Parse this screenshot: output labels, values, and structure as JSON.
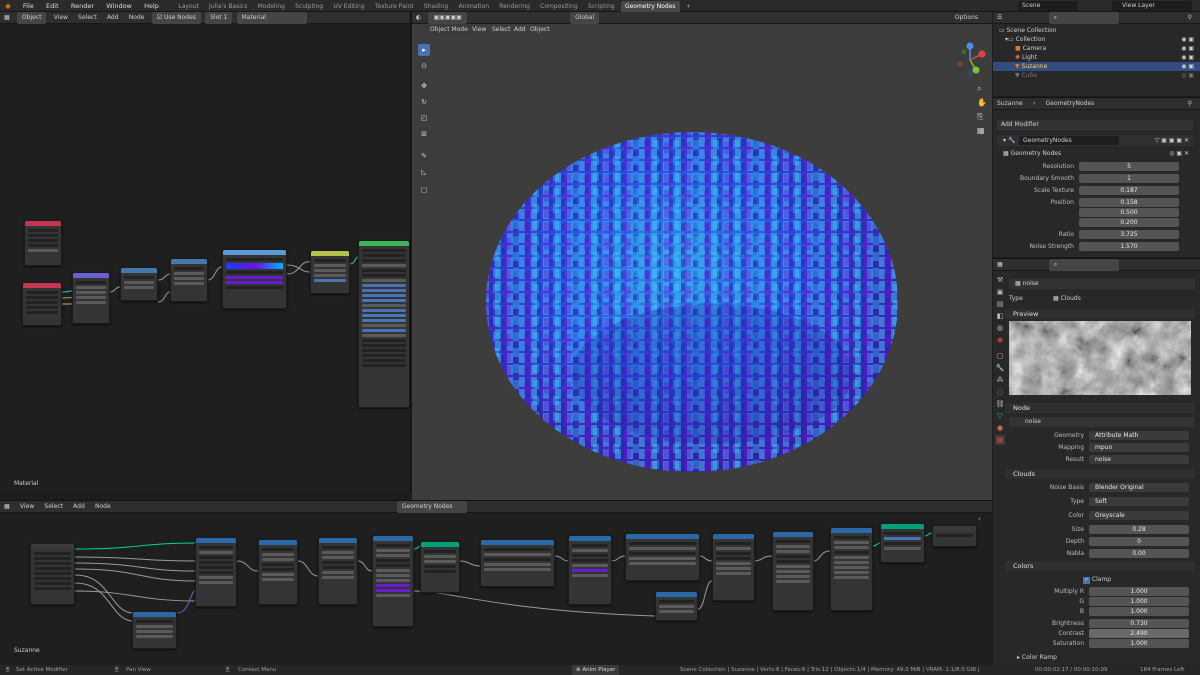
{
  "app": {
    "blender_icon": "blender-logo-icon"
  },
  "menu": [
    "File",
    "Edit",
    "Render",
    "Window",
    "Help"
  ],
  "workspaces": [
    "Layout",
    "Julia's Basics",
    "Modeling",
    "Sculpting",
    "UV Editing",
    "Texture Paint",
    "Shading",
    "Animation",
    "Rendering",
    "Compositing",
    "Scripting",
    "Geometry Nodes"
  ],
  "active_workspace": "Geometry Nodes",
  "scene": {
    "label": "Scene",
    "view_layer": "View Layer"
  },
  "shader_editor": {
    "mode": "Object",
    "menus": [
      "View",
      "Select",
      "Add",
      "Node"
    ],
    "use_nodes_label": "Use Nodes",
    "slot": "Slot 1",
    "material": "Material",
    "footer_label": "Material"
  },
  "viewport": {
    "mode": "Object Mode",
    "menus": [
      "View",
      "Select",
      "Add",
      "Object"
    ],
    "transform": "Global",
    "options_label": "Options"
  },
  "geo_editor": {
    "menus": [
      "View",
      "Select",
      "Add",
      "Node"
    ],
    "tree_name": "Geometry Nodes",
    "footer_label": "Suzanne",
    "node_titles": [
      "Group Input",
      "Attribute Vector",
      "Attribute Vector",
      "Attribute Vector",
      "Attribute Vector",
      "Attribute Mix",
      "Attribute Sample Texture",
      "Attribute Math",
      "Attribute Sample Texture",
      "Attribute Vector",
      "Attribute Vector",
      "Attribute Math",
      "Join Geometry",
      "Group Output"
    ],
    "small_values": [
      "0.000",
      "1.000",
      "Vector",
      "Geometry",
      "Result",
      "noise",
      "Color",
      "CAO"
    ]
  },
  "outliner": {
    "root": "Scene Collection",
    "items": [
      {
        "label": "Collection",
        "icon": "collection-icon"
      },
      {
        "label": "Camera",
        "icon": "camera-icon"
      },
      {
        "label": "Light",
        "icon": "light-icon"
      },
      {
        "label": "Suzanne",
        "icon": "mesh-icon"
      },
      {
        "label": "Cube",
        "icon": "mesh-icon"
      }
    ]
  },
  "modifier_panel": {
    "object": "Suzanne",
    "tree": "GeometryNodes",
    "add_modifier": "Add Modifier",
    "modifier_name": "GeometryNodes",
    "subheader": "Geometry Nodes",
    "fields": [
      {
        "label": "Resolution",
        "value": "5"
      },
      {
        "label": "Boundary Smooth",
        "value": "1"
      },
      {
        "label": "Scale Texture",
        "value": "0.187"
      },
      {
        "label": "Position",
        "value": "0.158"
      },
      {
        "label": "",
        "value": "0.500"
      },
      {
        "label": "",
        "value": "0.200"
      },
      {
        "label": "Ratio",
        "value": "3.725"
      },
      {
        "label": "Noise Strength",
        "value": "1.570"
      }
    ]
  },
  "texture_panel": {
    "texture_name": "noise",
    "type_label": "Type",
    "type_value": "Clouds",
    "preview_label": "Preview",
    "node_section": "Node",
    "node_field": "noise",
    "node_rows": [
      {
        "label": "Geometry",
        "value": "Attribute Math"
      },
      {
        "label": "Mapping",
        "value": "mpuo"
      },
      {
        "label": "Result",
        "value": "noise"
      }
    ],
    "clouds_section": "Clouds",
    "clouds_rows": [
      {
        "label": "Noise Basis",
        "value": "Blender Original"
      },
      {
        "label": "Type",
        "value": "Soft"
      },
      {
        "label": "Color",
        "value": "Greyscale"
      },
      {
        "label": "Size",
        "value": "0.28"
      },
      {
        "label": "Depth",
        "value": "0"
      },
      {
        "label": "Nabla",
        "value": "0.00"
      }
    ],
    "colors_section": "Colors",
    "clamp_label": "Clamp",
    "color_rows": [
      {
        "label": "Multiply R",
        "value": "1.000"
      },
      {
        "label": "G",
        "value": "1.000"
      },
      {
        "label": "B",
        "value": "1.000"
      },
      {
        "label": "Brightness",
        "value": "0.730"
      },
      {
        "label": "Contrast",
        "value": "2.490"
      },
      {
        "label": "Saturation",
        "value": "1.000"
      }
    ],
    "color_ramp": "Color Ramp"
  },
  "status": {
    "left": "Set Active Modifier",
    "pan": "Pan View",
    "context": "Context Menu",
    "center": "Anim Player",
    "stats": "Scene Collection | Suzanne | Verts:8 | Faces:6 | Tris:12 | Objects:1/4 | Memory: 49.0 MiB | VRAM: 1.1/8.0 GiB | 3.0.0 Alpha",
    "time": "00:00:02:17 / 00:00:10:09",
    "frames": "184 Frames Left"
  }
}
